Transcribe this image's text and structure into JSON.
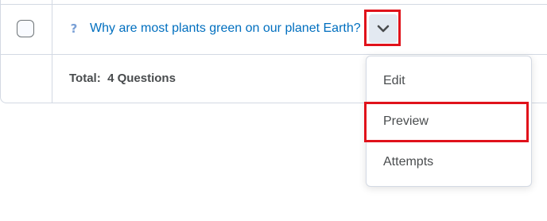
{
  "question": {
    "icon": "question-mark-icon",
    "title": "Why are most plants green on our planet Earth?"
  },
  "row_actions": {
    "icon": "chevron-down-icon"
  },
  "footer": {
    "total_label": "Total:",
    "total_value": "4 Questions"
  },
  "context_menu": {
    "items": [
      {
        "label": "Edit"
      },
      {
        "label": "Preview"
      },
      {
        "label": "Attempts"
      }
    ]
  },
  "colors": {
    "link": "#006fbf",
    "highlight": "#e0121b",
    "text": "#494c4e",
    "button_bg": "#e3e9f1"
  }
}
